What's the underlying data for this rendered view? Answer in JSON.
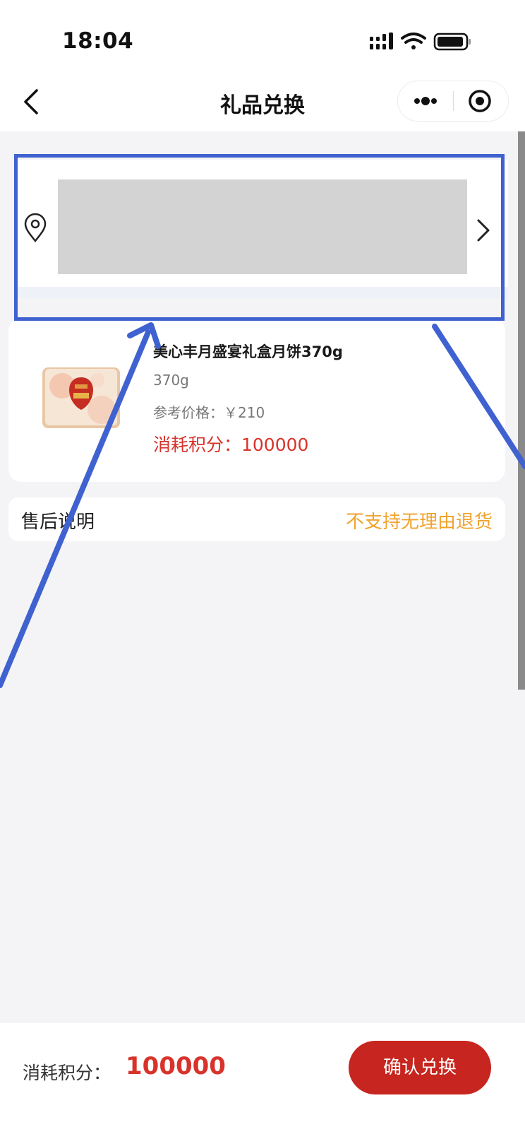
{
  "status_bar": {
    "time": "18:04"
  },
  "nav": {
    "title": "礼品兑换"
  },
  "product": {
    "name": "美心丰月盛宴礼盒月饼370g",
    "spec": "370g",
    "price_label": "参考价格：￥210",
    "points_label": "消耗积分：100000"
  },
  "after_sale": {
    "label": "售后说明",
    "value": "不支持无理由退货"
  },
  "footer": {
    "points_label": "消耗积分：",
    "points_value": "100000",
    "confirm_label": "确认兑换"
  },
  "colors": {
    "accent_red": "#c7251f",
    "points_red": "#d8332b",
    "warning_orange": "#f0a32e",
    "annotation_blue": "#3f62d0"
  },
  "icons": [
    "back-chevron",
    "more-dots",
    "target-circle",
    "location-pin",
    "chevron-right",
    "signal",
    "wifi",
    "battery"
  ]
}
